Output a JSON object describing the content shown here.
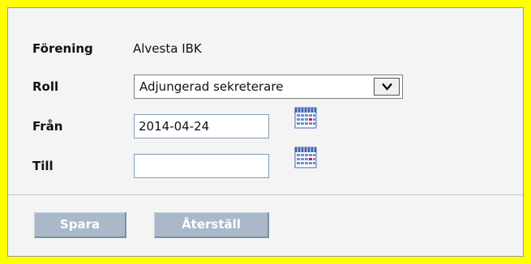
{
  "form": {
    "forening": {
      "label": "Förening",
      "value": "Alvesta IBK"
    },
    "roll": {
      "label": "Roll",
      "selected": "Adjungerad sekreterare"
    },
    "fran": {
      "label": "Från",
      "value": "2014-04-24"
    },
    "till": {
      "label": "Till",
      "value": ""
    }
  },
  "buttons": {
    "save": "Spara",
    "reset": "Återställ"
  },
  "icons": {
    "calendar": "calendar-icon",
    "dropdown": "chevron-down-icon"
  },
  "colors": {
    "frame": "#ffff00",
    "panel": "#f4f4f4",
    "button": "#a9b9c9"
  }
}
